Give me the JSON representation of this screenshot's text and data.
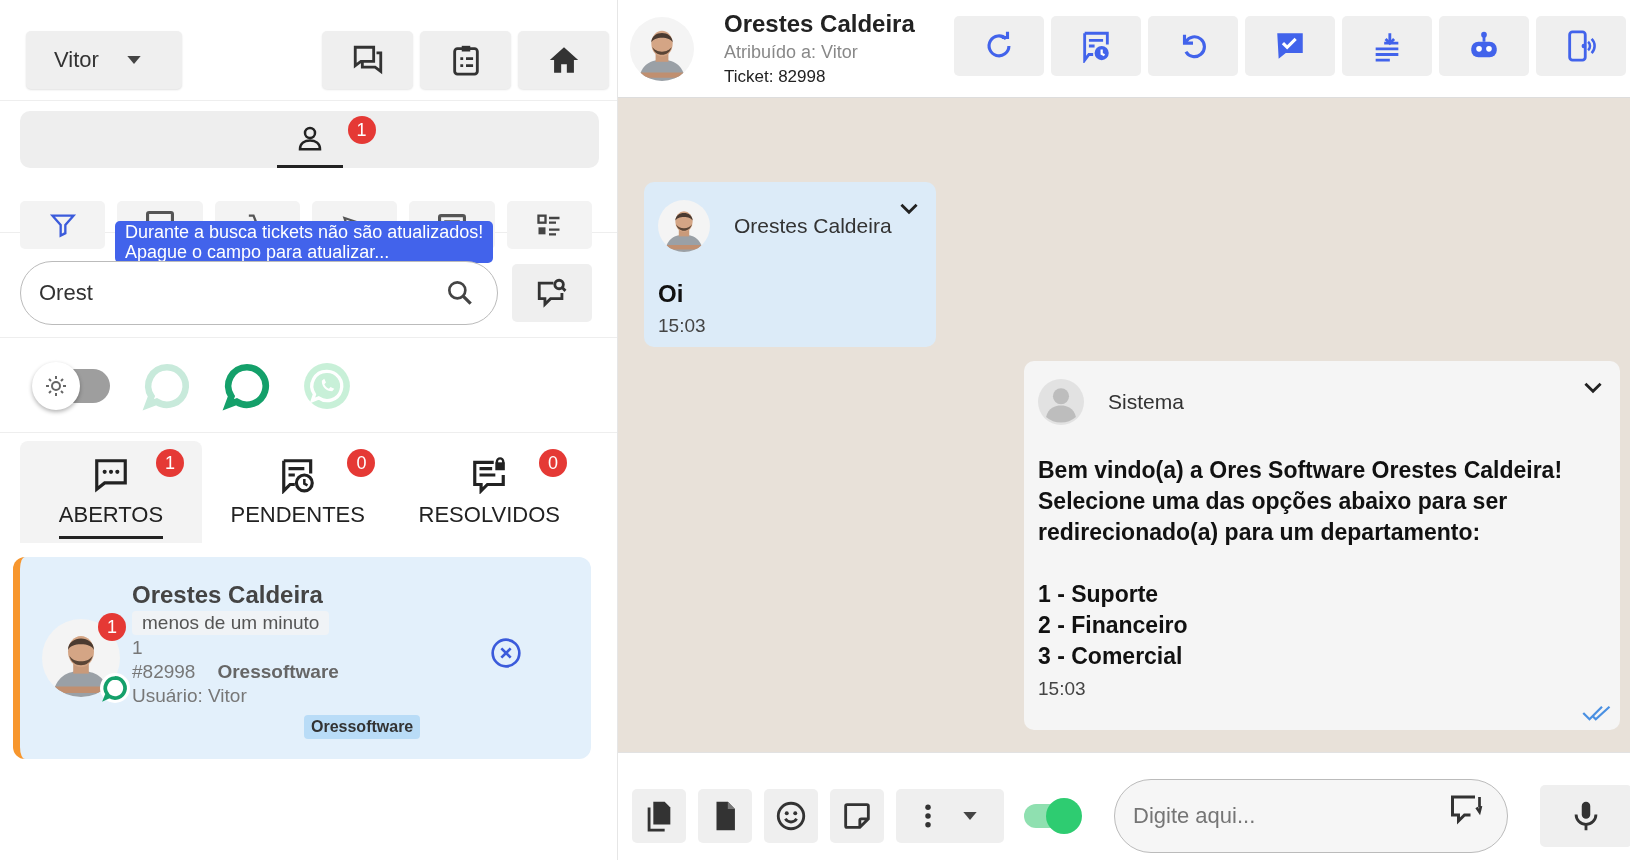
{
  "user_menu": {
    "label": "Vitor"
  },
  "queue_tab": {
    "badge": "1",
    "selected": true
  },
  "filter_active": true,
  "search_notice": "Durante a busca tickets não são atualizados!\nApague o campo para atualizar...",
  "search": {
    "value": "Orest"
  },
  "theme_toggle": {
    "on": false
  },
  "channels": [
    {
      "kind": "chat",
      "selected": false
    },
    {
      "kind": "chat",
      "selected": true
    },
    {
      "kind": "whatsapp",
      "selected": false
    }
  ],
  "status_tabs": [
    {
      "label": "ABERTOS",
      "badge": "1",
      "selected": true
    },
    {
      "label": "PENDENTES",
      "badge": "0",
      "selected": false
    },
    {
      "label": "RESOLVIDOS",
      "badge": "0",
      "selected": false
    }
  ],
  "tickets": [
    {
      "name": "Orestes Caldeira",
      "time": "menos de um minuto",
      "unread": "1",
      "last_message": "1",
      "number": "#82998",
      "connection": "Oressoftware",
      "user": "Usuário: Vitor",
      "tag": "Oressoftware",
      "selected": true
    }
  ],
  "chat_header": {
    "name": "Orestes Caldeira",
    "assigned": "Atribuído a: Vitor",
    "ticket": "Ticket: 82998"
  },
  "messages": [
    {
      "kind": "contact",
      "sender": "Orestes Caldeira",
      "text": "Oi",
      "time": "15:03",
      "read": false
    },
    {
      "kind": "system",
      "sender": "Sistema",
      "text": "Bem vindo(a) a Ores Software Orestes Caldeira!\nSelecione uma das opções abaixo para ser\nredirecionado(a) para um departamento:\n\n1 - Suporte\n2 - Financeiro\n3 - Comercial",
      "time": "15:03",
      "read": true
    }
  ],
  "composer": {
    "placeholder": "Digite aqui...",
    "signature_on": true
  }
}
